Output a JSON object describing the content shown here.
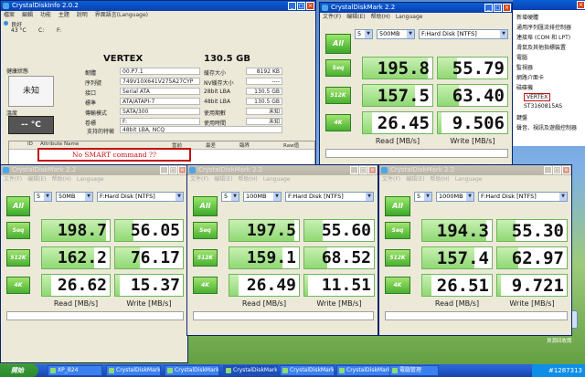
{
  "cdi": {
    "title": "CrystalDiskInfo 2.0.2",
    "menu": [
      "檔案",
      "編輯",
      "功能",
      "主題",
      "說明",
      "界面語言(Language)"
    ],
    "drive_tab": {
      "status": "良好",
      "temp": "43 °C",
      "letter": "C:",
      "letter2": "F:"
    },
    "model": "VERTEX",
    "capacity": "130.5 GB",
    "health_label": "健康狀態",
    "health_value": "未知",
    "temp_label": "溫度",
    "temp_value": "-- °C",
    "fields": [
      {
        "label": "韌體",
        "value": "00.P7.1"
      },
      {
        "label": "序列號",
        "value": "749V10X641V275A27CYP"
      },
      {
        "label": "接口",
        "value": "Serial ATA"
      },
      {
        "label": "標準",
        "value": "ATA/ATAPI-7"
      },
      {
        "label": "傳輸模式",
        "value": "SATA/300"
      },
      {
        "label": "卷標",
        "value": "F:"
      }
    ],
    "features_label": "支持的特徵",
    "features_value": "48bit LBA, NCQ",
    "right_fields": [
      {
        "label": "緩存大小",
        "value": "8192 KB"
      },
      {
        "label": "NV緩存大小",
        "value": "----"
      },
      {
        "label": "28bit LBA",
        "value": "130.5 GB"
      },
      {
        "label": "48bit LBA",
        "value": "130.5 GB"
      },
      {
        "label": "使用期數",
        "value": "未知"
      },
      {
        "label": "使用時間",
        "value": "未知"
      }
    ],
    "table_headers": [
      "ID",
      "Attribute Name",
      "當前",
      "最差",
      "臨界",
      "Raw值"
    ],
    "no_smart": "No SMART command ??"
  },
  "cdm_windows": [
    {
      "title": "CrystalDiskMark 2.2",
      "count": "5",
      "size": "500MB",
      "drive": "F:Hard Disk [NTFS]",
      "read": [
        "195.8",
        "157.5",
        "26.45"
      ],
      "write": [
        "55.79",
        "63.40",
        "9.506"
      ],
      "read_fill": [
        0.93,
        0.75,
        0.13
      ],
      "write_fill": [
        0.27,
        0.3,
        0.05
      ]
    },
    {
      "title": "CrystalDiskMark 2.2",
      "count": "5",
      "size": "50MB",
      "drive": "F:Hard Disk [NTFS]",
      "read": [
        "198.7",
        "162.2",
        "26.62"
      ],
      "write": [
        "56.05",
        "76.17",
        "15.37"
      ],
      "read_fill": [
        0.94,
        0.77,
        0.13
      ],
      "write_fill": [
        0.27,
        0.36,
        0.07
      ]
    },
    {
      "title": "CrystalDiskMark 2.2",
      "count": "5",
      "size": "100MB",
      "drive": "F:Hard Disk [NTFS]",
      "read": [
        "197.5",
        "159.1",
        "26.49"
      ],
      "write": [
        "55.60",
        "68.52",
        "11.51"
      ],
      "read_fill": [
        0.94,
        0.76,
        0.13
      ],
      "write_fill": [
        0.26,
        0.33,
        0.05
      ]
    },
    {
      "title": "CrystalDiskMark 2.2",
      "count": "5",
      "size": "1000MB",
      "drive": "F:Hard Disk [NTFS]",
      "read": [
        "194.3",
        "157.4",
        "26.51"
      ],
      "write": [
        "55.30",
        "62.97",
        "9.721"
      ],
      "read_fill": [
        0.92,
        0.75,
        0.13
      ],
      "write_fill": [
        0.26,
        0.3,
        0.05
      ]
    }
  ],
  "cdm_common": {
    "menu": [
      "文件(F)",
      "编辑(E)",
      "帮助(H)",
      "Language"
    ],
    "all_label": "All",
    "test_labels": [
      "Seq",
      "512K",
      "4K"
    ],
    "read_header": "Read [MB/s]",
    "write_header": "Write [MB/s]"
  },
  "explorer": {
    "items": [
      "新增硬體",
      "通用序列匯流排控制器",
      "連接埠 (COM 和 LPT)",
      "滑鼠及其他指標裝置",
      "電腦",
      "監視器",
      "網路介面卡",
      "磁碟機",
      "VERTEX",
      "ST3160815AS",
      "鍵盤",
      "聲音、視訊及遊戲控制器"
    ]
  },
  "taskbar": {
    "start": "開始",
    "items": [
      "XP_B24",
      "CrystalDiskMark 2.2",
      "CrystalDiskMark 2.2",
      "CrystalDiskMark 2.2",
      "CrystalDiskMark 2.2",
      "CrystalDiskMark 2.2",
      "電腦管理"
    ],
    "clock": "#1287313",
    "recycle_label": "資源回收筒"
  }
}
